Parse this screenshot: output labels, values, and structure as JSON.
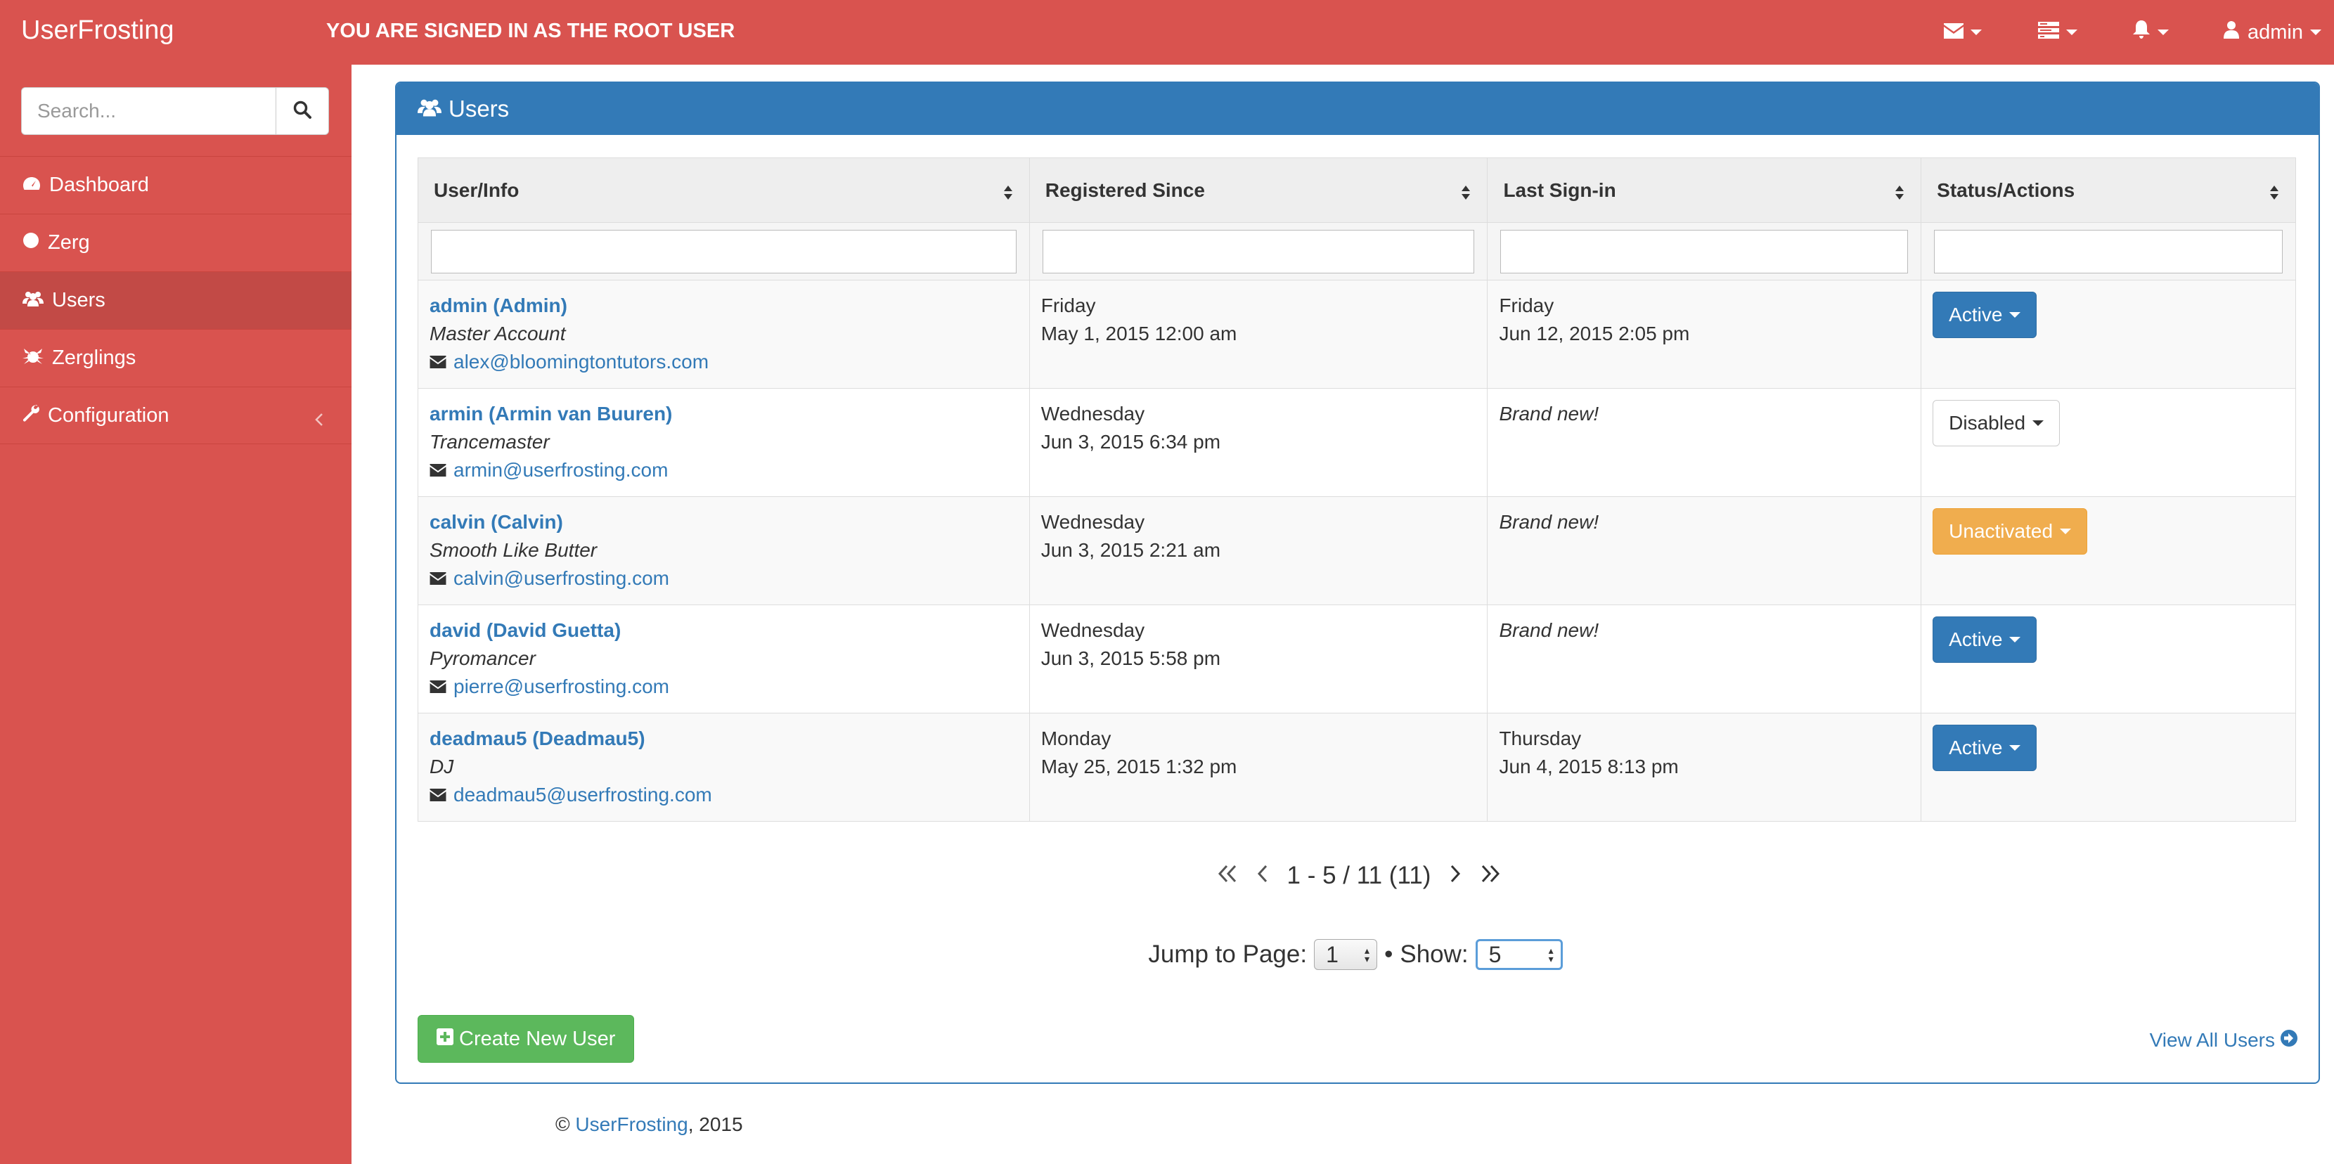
{
  "navbar": {
    "brand": "UserFrosting",
    "notice": "YOU ARE SIGNED IN AS THE ROOT USER",
    "user_label": "admin",
    "icons": [
      "envelope-icon",
      "tasks-icon",
      "bell-icon",
      "user-icon"
    ]
  },
  "sidebar": {
    "search_placeholder": "Search...",
    "items": [
      {
        "label": "Dashboard",
        "icon": "dashboard-icon"
      },
      {
        "label": "Zerg",
        "icon": "cog-icon"
      },
      {
        "label": "Users",
        "icon": "users-icon",
        "active": true
      },
      {
        "label": "Zerglings",
        "icon": "bug-icon"
      },
      {
        "label": "Configuration",
        "icon": "wrench-icon"
      }
    ]
  },
  "panel": {
    "title": "Users",
    "columns": [
      "User/Info",
      "Registered Since",
      "Last Sign-in",
      "Status/Actions"
    ],
    "rows": [
      {
        "name": "admin (Admin)",
        "title": "Master Account",
        "email": "alex@bloomingtontutors.com",
        "reg_day": "Friday",
        "reg_date": "May 1, 2015 12:00 am",
        "last_day": "Friday",
        "last_date": "Jun 12, 2015 2:05 pm",
        "brand_new": "",
        "status": "Active",
        "status_color": "#337ab7"
      },
      {
        "name": "armin (Armin van Buuren)",
        "title": "Trancemaster",
        "email": "armin@userfrosting.com",
        "reg_day": "Wednesday",
        "reg_date": "Jun 3, 2015 6:34 pm",
        "last_day": "",
        "last_date": "",
        "brand_new": "Brand new!",
        "status": "Disabled",
        "status_color": "#ffffff"
      },
      {
        "name": "calvin (Calvin)",
        "title": "Smooth Like Butter",
        "email": "calvin@userfrosting.com",
        "reg_day": "Wednesday",
        "reg_date": "Jun 3, 2015 2:21 am",
        "last_day": "",
        "last_date": "",
        "brand_new": "Brand new!",
        "status": "Unactivated",
        "status_color": "#f0ad4e"
      },
      {
        "name": "david (David Guetta)",
        "title": "Pyromancer",
        "email": "pierre@userfrosting.com",
        "reg_day": "Wednesday",
        "reg_date": "Jun 3, 2015 5:58 pm",
        "last_day": "",
        "last_date": "",
        "brand_new": "Brand new!",
        "status": "Active",
        "status_color": "#337ab7"
      },
      {
        "name": "deadmau5 (Deadmau5)",
        "title": "DJ",
        "email": "deadmau5@userfrosting.com",
        "reg_day": "Monday",
        "reg_date": "May 25, 2015 1:32 pm",
        "last_day": "Thursday",
        "last_date": "Jun 4, 2015 8:13 pm",
        "brand_new": "",
        "status": "Active",
        "status_color": "#337ab7"
      }
    ],
    "pager": {
      "range_text": "1 - 5 / 11 (11)",
      "jump_label": "Jump to Page:",
      "jump_value": "1",
      "separator": "•",
      "show_label": "Show:",
      "show_value": "5"
    },
    "create_label": "Create New User",
    "view_all_label": "View All Users"
  },
  "footer": {
    "copyright": "©",
    "link": "UserFrosting",
    "year": ", 2015"
  }
}
